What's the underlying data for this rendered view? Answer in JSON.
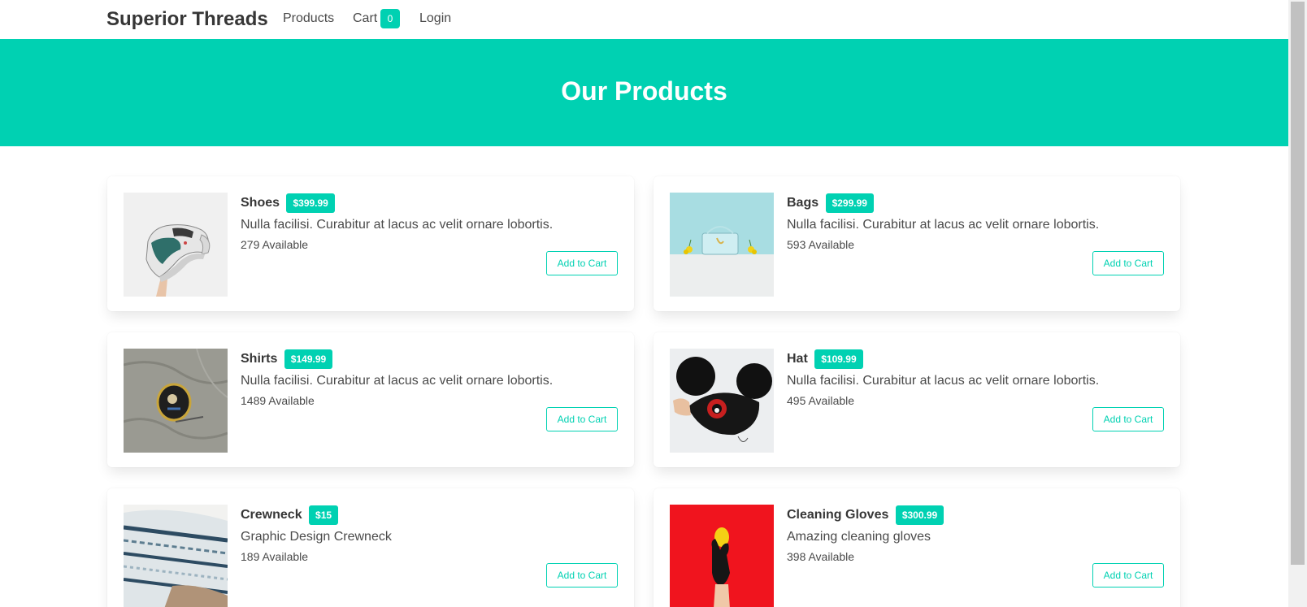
{
  "navbar": {
    "brand": "Superior Threads",
    "products": "Products",
    "cart": "Cart",
    "cart_count": "0",
    "login": "Login"
  },
  "hero": {
    "title": "Our Products"
  },
  "products": [
    {
      "name": "Shoes",
      "price": "$399.99",
      "description": "Nulla facilisi. Curabitur at lacus ac velit ornare lobortis.",
      "available": "279 Available",
      "button": "Add to Cart",
      "image": "shoe-image"
    },
    {
      "name": "Bags",
      "price": "$299.99",
      "description": "Nulla facilisi. Curabitur at lacus ac velit ornare lobortis.",
      "available": "593 Available",
      "button": "Add to Cart",
      "image": "bag-image"
    },
    {
      "name": "Shirts",
      "price": "$149.99",
      "description": "Nulla facilisi. Curabitur at lacus ac velit ornare lobortis.",
      "available": "1489 Available",
      "button": "Add to Cart",
      "image": "shirt-image"
    },
    {
      "name": "Hat",
      "price": "$109.99",
      "description": "Nulla facilisi. Curabitur at lacus ac velit ornare lobortis.",
      "available": "495 Available",
      "button": "Add to Cart",
      "image": "hat-image"
    },
    {
      "name": "Crewneck",
      "price": "$15",
      "description": "Graphic Design Crewneck",
      "available": "189 Available",
      "button": "Add to Cart",
      "image": "crewneck-image"
    },
    {
      "name": "Cleaning Gloves",
      "price": "$300.99",
      "description": "Amazing cleaning gloves",
      "available": "398 Available",
      "button": "Add to Cart",
      "image": "gloves-image"
    }
  ],
  "colors": {
    "accent": "#00d1b2",
    "text": "#4a4a4a",
    "heading": "#363636"
  }
}
